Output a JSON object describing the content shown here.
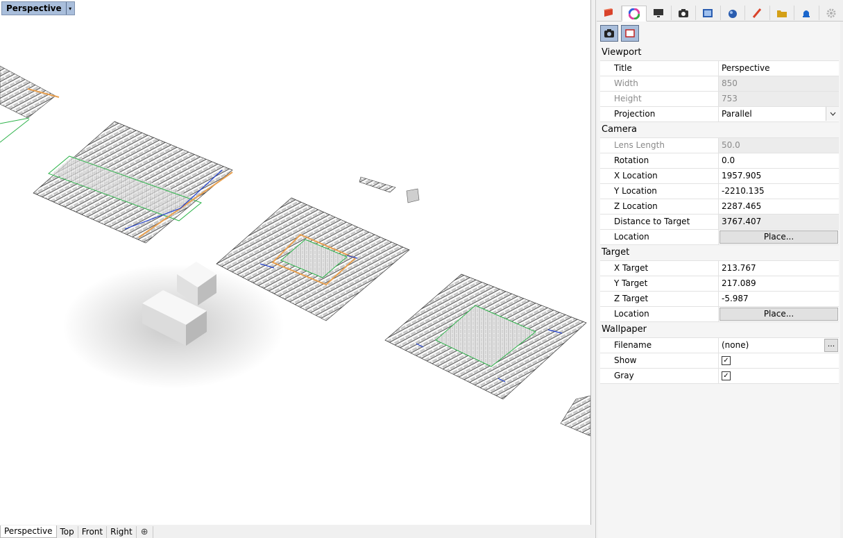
{
  "viewport": {
    "title": "Perspective",
    "dropdown_glyph": "▾"
  },
  "view_tabs": {
    "tabs": [
      "Perspective",
      "Top",
      "Front",
      "Right"
    ],
    "add_glyph": "⊕"
  },
  "panel": {
    "tabs": [
      {
        "icon": "layers-icon",
        "color": "#d9432b"
      },
      {
        "icon": "color-wheel-icon",
        "color": "#e040a0"
      },
      {
        "icon": "display-icon",
        "color": "#333333"
      },
      {
        "icon": "camera-icon",
        "color": "#333333"
      },
      {
        "icon": "named-views-icon",
        "color": "#2a5db0"
      },
      {
        "icon": "material-sphere-icon",
        "color": "#2a5db0"
      },
      {
        "icon": "brush-icon",
        "color": "#d9432b"
      },
      {
        "icon": "folder-icon",
        "color": "#d4a017"
      },
      {
        "icon": "bell-icon",
        "color": "#1a66cc"
      },
      {
        "icon": "gear-icon",
        "color": "#b0b0b0"
      }
    ],
    "sections": {
      "viewport": {
        "label": "Viewport",
        "title_label": "Title",
        "title_value": "Perspective",
        "width_label": "Width",
        "width_value": "850",
        "height_label": "Height",
        "height_value": "753",
        "projection_label": "Projection",
        "projection_value": "Parallel"
      },
      "camera": {
        "label": "Camera",
        "lens_label": "Lens Length",
        "lens_value": "50.0",
        "rotation_label": "Rotation",
        "rotation_value": "0.0",
        "x_label": "X Location",
        "x_value": "1957.905",
        "y_label": "Y Location",
        "y_value": "-2210.135",
        "z_label": "Z Location",
        "z_value": "2287.465",
        "dist_label": "Distance to Target",
        "dist_value": "3767.407",
        "location_label": "Location",
        "place_label": "Place..."
      },
      "target": {
        "label": "Target",
        "x_label": "X Target",
        "x_value": "213.767",
        "y_label": "Y Target",
        "y_value": "217.089",
        "z_label": "Z Target",
        "z_value": "-5.987",
        "location_label": "Location",
        "place_label": "Place..."
      },
      "wallpaper": {
        "label": "Wallpaper",
        "filename_label": "Filename",
        "filename_value": "(none)",
        "browse_label": "...",
        "show_label": "Show",
        "show_checked": "✓",
        "gray_label": "Gray",
        "gray_checked": "✓"
      }
    }
  }
}
